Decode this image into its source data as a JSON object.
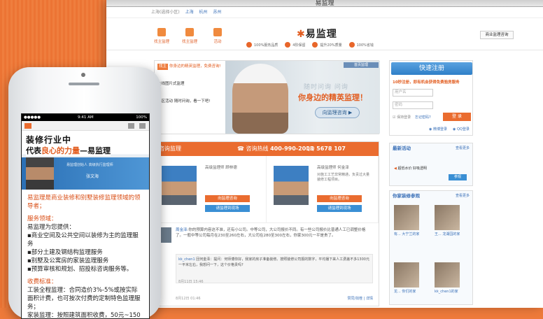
{
  "window": {
    "title": "易监理"
  },
  "topbar": {
    "prefix": "上海(选择小区)",
    "cities": [
      "上海",
      "杭州",
      "苏州"
    ]
  },
  "nav": [
    {
      "label": "找主监理"
    },
    {
      "label": "找主监理"
    },
    {
      "label": "活动"
    }
  ],
  "brand": {
    "name": "易监理"
  },
  "features": [
    "100%服务品质",
    "4阶保留",
    "提升20%质量",
    "100%省钱"
  ],
  "header_button": "商业监理咨询",
  "banner": {
    "left_items": [
      {
        "tag": "找主",
        "text": "你身边的精英监理，免费咨询!"
      },
      {
        "tag": "",
        "text": "在线图片式监理"
      },
      {
        "tag": "",
        "text": "小区活动 随时问询，看一下吧!"
      }
    ],
    "tab": "首页监理",
    "slogan_grey": "随时问询   问询",
    "slogan": "你身边的精英监理！",
    "button": "向监理咨询"
  },
  "consult": {
    "title": "咨询监理",
    "phone_label": "咨询热线",
    "phone": "400-990-2013",
    "qq_label": "QQ",
    "qq": "5678 107"
  },
  "experts": [
    {
      "name": "高级监理师  顾林德",
      "desc": "",
      "btn1": "向监理咨询",
      "btn2": "请监理到现场"
    },
    {
      "name": "高级监理师  何金泽",
      "desc": "对施工工艺非常精通，负责过大量装修工程项目。",
      "btn1": "向监理咨询",
      "btn2": "请监理到现场"
    }
  ],
  "qa": {
    "user": "周金泽",
    "question": ":你的预算内容这不准，还有小公司。中等公司，大公司报价不同。有一些公司报价比普通人工已调整价格了。一般中等公司每月在230至260左右，大公司在280至300左右，你家300元一平是贵了。",
    "reply_user": "kk_chen1",
    "reply_text": " 回何金泽：提问：何师傅你好，我家的房子准备装修。按照装修公司报的数字，平均播下来人工费差不多1300元一平米左右，我想问一下，这个价格贵吗?",
    "reply_time": "8月11日 15:46",
    "time": "8月12日 01:46",
    "actions": "赞同/找茬  |  详情"
  },
  "register": {
    "button": "快速注册",
    "tagline": "10秒注册，即有机会获得免费验房服务",
    "username_placeholder": "用户名",
    "password_placeholder": "密码",
    "auto_login": "保持登录",
    "forgot": "忘记密码?",
    "login": "登 录",
    "weibo": "微博登录",
    "qq": "QQ登录"
  },
  "latest": {
    "title": "最新活动",
    "more": "查看更多",
    "item": "超低水价 好吸透明",
    "btn": "参观"
  },
  "cases": {
    "title": "你家装修参观",
    "more": "查看更多",
    "items": [
      "有... 大宁兰的家",
      "王... 龙湖园的家",
      "龙... 你们的家",
      "kk_chen1的家"
    ]
  },
  "phone": {
    "carrier": "●●●●● ",
    "time": "9:41 AM",
    "battery": "100%",
    "hero_line1": "装修行业中",
    "hero_line2_pre": "代表",
    "hero_line2_hl": "良心的力量",
    "hero_line2_post": "—易监理",
    "hero_caption": "易监理创始人 高级执行监理师",
    "hero_name": "张文海",
    "intro": "易监理是商业装修和别墅装修监理领域的领导者；",
    "service_title": "服务领域：",
    "service_lines": [
      "易监理为您提供：",
      "▪商业空间及公共空间以装修为主的监理服务",
      "▪部分土建及钢结构监理服务",
      "▪别墅及公寓房的家装监理服务",
      "▪预算审核和规划、招投标咨询服务等。"
    ],
    "fee_title": "收费标准：",
    "fee_lines": [
      "工装全程监理：合同造价3%-5%或按实际面积计费，也可按次付费的定制特色监理服务；",
      "家装监理：按照建筑面积收费，50元~150元/平"
    ]
  }
}
